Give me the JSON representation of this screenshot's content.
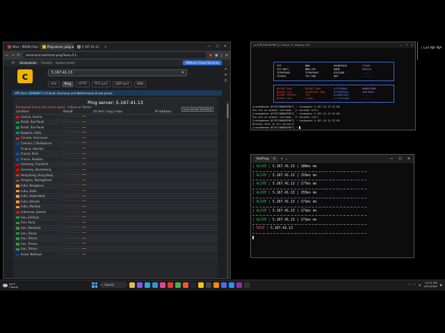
{
  "browser": {
    "tabs": [
      {
        "label": "Mars - MAGB (Clip Official) - Y",
        "color": "#c0392b",
        "active": false
      },
      {
        "label": "Ping server, ping website - Chec",
        "color": "#f0b400",
        "active": true
      },
      {
        "label": "5.167.41.13",
        "color": "#888888",
        "active": false
      }
    ],
    "new_tab": "+",
    "window_controls": [
      "—",
      "☐",
      "✕"
    ],
    "nav": {
      "back": "←",
      "forward": "→",
      "reload": "⟳"
    },
    "url": "check-host.net/check-ping?host=5.1...",
    "page": {
      "top_ip_label": "IP:",
      "top_ip": "xx.xx.xx.xx",
      "country_label": "Country:",
      "country_value": "xxxxxx (xxxx)",
      "cloud_button": "Offshore Cloud Services",
      "logo_letter": "c",
      "host_input": "5.167.41.13",
      "clear_x": "✕",
      "check_tabs": [
        "Info",
        "Ping",
        "HTTP",
        "TCP port",
        "UDP port",
        "DNS"
      ],
      "active_tab": "Ping",
      "vps_text_prefix": "VPS from",
      "vps_brand": "U1HOST",
      "vps_text_suffix": "in Finland, Germany and Netherlands at low prices",
      "panel_title": "Ping server: 5.167.41.13",
      "permalink": "Permanent link to this check report",
      "share": "| Share on Twitter",
      "live_btn": "Live server terminal",
      "columns": [
        "Location",
        "Result",
        "rtt min / avg / max",
        "IP address"
      ],
      "rows": [
        {
          "location": "Austria, Vienna",
          "flag": "#c8102e"
        },
        {
          "location": "Brazil, Sao Paulo",
          "flag": "#009c3b"
        },
        {
          "location": "Brazil, Sao Paulo",
          "flag": "#009c3b"
        },
        {
          "location": "Bulgaria, Sofia",
          "flag": "#00966e"
        },
        {
          "location": "Canada, Vancouver",
          "flag": "#d52b1e"
        },
        {
          "location": "Czechia, C.Budejovice",
          "flag": "#11457e"
        },
        {
          "location": "Finland, Helsinki",
          "flag": "#003580"
        },
        {
          "location": "France, Paris",
          "flag": "#0055a4"
        },
        {
          "location": "France, Roubaix",
          "flag": "#0055a4"
        },
        {
          "location": "Germany, Frankfurt",
          "flag": "#dd0000"
        },
        {
          "location": "Germany, Nuremberg",
          "flag": "#dd0000"
        },
        {
          "location": "Hong Kong, Hong Kong",
          "flag": "#de2910"
        },
        {
          "location": "Hungary, Nyiregyhaza",
          "flag": "#436f4d"
        },
        {
          "location": "India, Bengaluru",
          "flag": "#ff9933"
        },
        {
          "location": "India, Delhi",
          "flag": "#ff9933"
        },
        {
          "location": "India, Hyderabad",
          "flag": "#ff9933"
        },
        {
          "location": "India, Kolkata",
          "flag": "#ff9933"
        },
        {
          "location": "India, Mumbai",
          "flag": "#ff9933"
        },
        {
          "location": "Indonesia, Jakarta",
          "flag": "#ce1126"
        },
        {
          "location": "Iran, Esfahan",
          "flag": "#239f40"
        },
        {
          "location": "Iran, Karaj",
          "flag": "#239f40"
        },
        {
          "location": "Iran, Mashhad",
          "flag": "#239f40"
        },
        {
          "location": "Iran, Shiraz",
          "flag": "#239f40"
        },
        {
          "location": "Iran, Tehran",
          "flag": "#239f40"
        },
        {
          "location": "Iran, Tehran",
          "flag": "#239f40"
        },
        {
          "location": "Iran, Tehran",
          "flag": "#239f40"
        },
        {
          "location": "Israel, Netanya",
          "flag": "#0038b8"
        }
      ],
      "result_dots": "• • • • • • ",
      "result_dots_end": "•••"
    }
  },
  "terminal": {
    "title": "[L-STATION BOTNET] | Online: 3 | Urgency: 4/3",
    "controls": [
      "—",
      "☐",
      "✕"
    ],
    "grid1": [
      [
        "TCP",
        "NBB",
        "OVHBYPASS",
        "FIVEM"
      ],
      [
        "TCP-BEST",
        "NBB-VIP",
        "GAME",
        "ROBLOX"
      ],
      [
        "TCPBYPASS",
        "TCPBYPASS",
        "DISCORD",
        "......"
      ],
      [
        "TCPACK",
        "TCP-PRO",
        "UDP",
        "......"
      ]
    ],
    "grid2": [
      [
        "BOTNET-RAW",
        "BOTNET-RAW",
        "HTTPSDDOS",
        "RANDSTORM"
      ],
      [
        "BOTNET-VIP",
        "TCPBYPASS-RAW",
        "HTTPBYPASS",
        "SYN-BEST"
      ],
      [
        "BOTNET-PERSIS",
        "TLS",
        "CLOUDFLARE",
        "......"
      ],
      [
        "BOTNET-ACK",
        "FLOOD",
        "L7-STATION",
        "......"
      ]
    ],
    "log": [
      "[rasdomhome @STATION$BOTNET] ~ tcpbypass 5.167.41.13 22 60",
      "You are on global cooldown. (1 seconds left)",
      "[rasdomhome @STATION$BOTNET] ~ tcpbypass 5.167.41.13 22 60",
      "You are on global cooldown. (1 seconds left)",
      "[rasdomhome @STATION$BOTNET] ~ tcpbypass 5.167.41.13 22 60",
      "Attacks Sent to all servers!",
      "[rasdomhome @STATION$BOTNET] ~ "
    ]
  },
  "netping": {
    "title": "NetPing",
    "tab_close": "✕",
    "new_tab": "+",
    "dropdown": "⌄",
    "controls": [
      "—",
      "☐",
      "✕"
    ],
    "lines": [
      {
        "status": "[ ALIVE ]",
        "ip": "5.167.41.13",
        "time": "| 180ms ms",
        "kind": "alive"
      },
      {
        "status": "[ ALIVE ]",
        "ip": "5.167.41.13",
        "time": "| 155ms ms",
        "kind": "alive"
      },
      {
        "status": "[ ALIVE ]",
        "ip": "5.167.41.13",
        "time": "| 177ms ms",
        "kind": "alive"
      },
      {
        "status": "[ ALIVE ]",
        "ip": "5.167.41.13",
        "time": "| 155ms ms",
        "kind": "alive"
      },
      {
        "status": "[ ALIVE ]",
        "ip": "5.167.41.13",
        "time": "| 171ms ms",
        "kind": "alive"
      },
      {
        "status": "[ ALIVE ]",
        "ip": "5.167.41.13",
        "time": "| 171ms ms",
        "kind": "alive"
      },
      {
        "status": "[ ALIVE ]",
        "ip": "5.167.41.13",
        "time": "| 171ms ms",
        "kind": "alive"
      },
      {
        "status": "[ DEAD ]",
        "ip": "5.167.41.13",
        "time": "",
        "kind": "dead"
      }
    ]
  },
  "topright": {
    "text": "| LoX  NJA  NJA"
  },
  "taskbar": {
    "weather_temp": "59°F",
    "weather_desc": "Cloudy",
    "search": "Search",
    "apps": [
      {
        "name": "files-app",
        "color": "#e8b84a"
      },
      {
        "name": "chat-app",
        "color": "#7c5cff"
      },
      {
        "name": "edge-app",
        "color": "#2aa7e0"
      },
      {
        "name": "store-app",
        "color": "#3a8dde"
      },
      {
        "name": "media-app",
        "color": "#e04a8a"
      },
      {
        "name": "red-app",
        "color": "#e53935"
      },
      {
        "name": "chrome-app",
        "color": "#4caf50"
      },
      {
        "name": "brave-app",
        "color": "#fb542b"
      },
      {
        "name": "steam-app",
        "color": "#1b2838"
      },
      {
        "name": "folder-app",
        "color": "#f5c518"
      },
      {
        "name": "terminal-app",
        "color": "#444444"
      },
      {
        "name": "orange-app",
        "color": "#ff8c00"
      },
      {
        "name": "discord-app",
        "color": "#5865f2"
      },
      {
        "name": "blue-app",
        "color": "#2196f3"
      },
      {
        "name": "purple-app",
        "color": "#9c27b0"
      },
      {
        "name": "dark-app",
        "color": "#333333"
      }
    ],
    "time": "12:31 PM",
    "date": "1/21/2026"
  }
}
